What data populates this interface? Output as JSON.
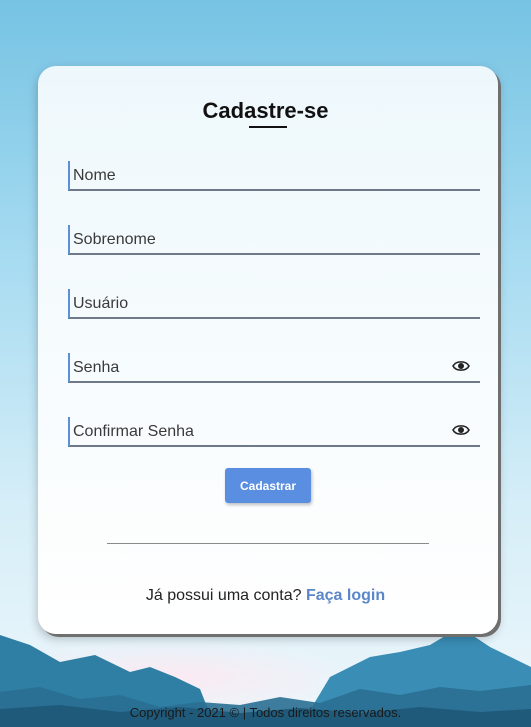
{
  "form": {
    "title": "Cadastre-se",
    "fields": [
      {
        "placeholder": "Nome",
        "value": ""
      },
      {
        "placeholder": "Sobrenome",
        "value": ""
      },
      {
        "placeholder": "Usuário",
        "value": ""
      },
      {
        "placeholder": "Senha",
        "value": ""
      },
      {
        "placeholder": "Confirmar Senha",
        "value": ""
      }
    ],
    "submit_label": "Cadastrar"
  },
  "login": {
    "prompt": "Já possui uma conta?",
    "link_label": "Faça login"
  },
  "footer": {
    "copyright": "Copyright - 2021 © | Todos direitos reservados."
  },
  "icons": {
    "password_toggle": "eye-icon"
  },
  "colors": {
    "accent": "#5a8ee0",
    "link": "#5b86c7"
  }
}
